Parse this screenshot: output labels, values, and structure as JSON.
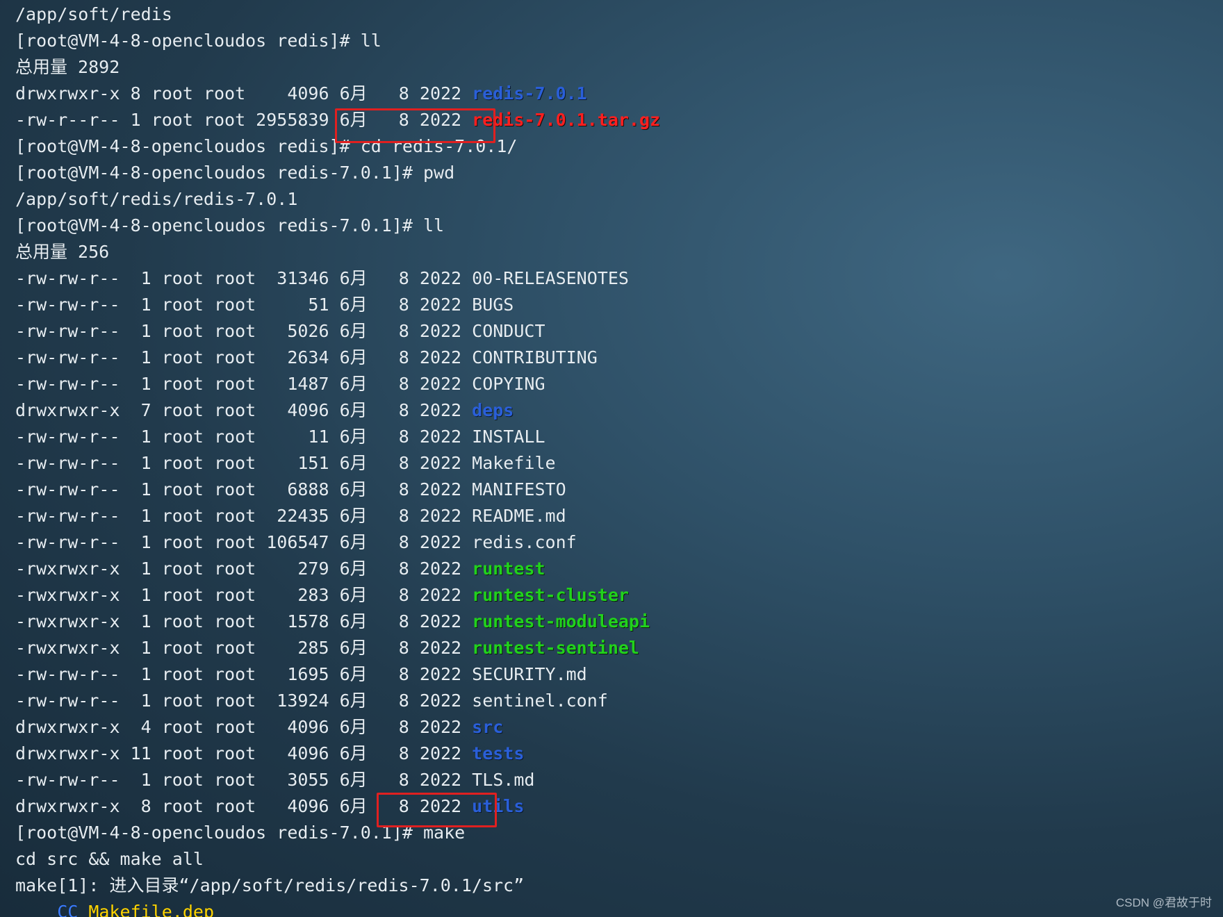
{
  "terminal": {
    "lines": [
      {
        "text": "/app/soft/redis"
      },
      {
        "text": "[root@VM-4-8-opencloudos redis]# ll"
      },
      {
        "text": "总用量 2892"
      },
      {
        "prefix": "drwxrwxr-x 8 root root    4096 6月   8 2022 ",
        "name": "redis-7.0.1",
        "color": "blue"
      },
      {
        "prefix": "-rw-r--r-- 1 root root 2955839 6月   8 2022 ",
        "name": "redis-7.0.1.tar.gz",
        "color": "red"
      },
      {
        "text": "[root@VM-4-8-opencloudos redis]# cd redis-7.0.1/"
      },
      {
        "text": "[root@VM-4-8-opencloudos redis-7.0.1]# pwd"
      },
      {
        "text": "/app/soft/redis/redis-7.0.1"
      },
      {
        "text": "[root@VM-4-8-opencloudos redis-7.0.1]# ll"
      },
      {
        "text": "总用量 256"
      },
      {
        "prefix": "-rw-rw-r--  1 root root  31346 6月   8 2022 ",
        "name": "00-RELEASENOTES"
      },
      {
        "prefix": "-rw-rw-r--  1 root root     51 6月   8 2022 ",
        "name": "BUGS"
      },
      {
        "prefix": "-rw-rw-r--  1 root root   5026 6月   8 2022 ",
        "name": "CONDUCT"
      },
      {
        "prefix": "-rw-rw-r--  1 root root   2634 6月   8 2022 ",
        "name": "CONTRIBUTING"
      },
      {
        "prefix": "-rw-rw-r--  1 root root   1487 6月   8 2022 ",
        "name": "COPYING"
      },
      {
        "prefix": "drwxrwxr-x  7 root root   4096 6月   8 2022 ",
        "name": "deps",
        "color": "blue"
      },
      {
        "prefix": "-rw-rw-r--  1 root root     11 6月   8 2022 ",
        "name": "INSTALL"
      },
      {
        "prefix": "-rw-rw-r--  1 root root    151 6月   8 2022 ",
        "name": "Makefile"
      },
      {
        "prefix": "-rw-rw-r--  1 root root   6888 6月   8 2022 ",
        "name": "MANIFESTO"
      },
      {
        "prefix": "-rw-rw-r--  1 root root  22435 6月   8 2022 ",
        "name": "README.md"
      },
      {
        "prefix": "-rw-rw-r--  1 root root 106547 6月   8 2022 ",
        "name": "redis.conf"
      },
      {
        "prefix": "-rwxrwxr-x  1 root root    279 6月   8 2022 ",
        "name": "runtest",
        "color": "green"
      },
      {
        "prefix": "-rwxrwxr-x  1 root root    283 6月   8 2022 ",
        "name": "runtest-cluster",
        "color": "green"
      },
      {
        "prefix": "-rwxrwxr-x  1 root root   1578 6月   8 2022 ",
        "name": "runtest-moduleapi",
        "color": "green"
      },
      {
        "prefix": "-rwxrwxr-x  1 root root    285 6月   8 2022 ",
        "name": "runtest-sentinel",
        "color": "green"
      },
      {
        "prefix": "-rw-rw-r--  1 root root   1695 6月   8 2022 ",
        "name": "SECURITY.md"
      },
      {
        "prefix": "-rw-rw-r--  1 root root  13924 6月   8 2022 ",
        "name": "sentinel.conf"
      },
      {
        "prefix": "drwxrwxr-x  4 root root   4096 6月   8 2022 ",
        "name": "src",
        "color": "blue"
      },
      {
        "prefix": "drwxrwxr-x 11 root root   4096 6月   8 2022 ",
        "name": "tests",
        "color": "blue"
      },
      {
        "prefix": "-rw-rw-r--  1 root root   3055 6月   8 2022 ",
        "name": "TLS.md"
      },
      {
        "prefix": "drwxrwxr-x  8 root root   4096 6月   8 2022 ",
        "name": "utils",
        "color": "blue"
      },
      {
        "text": "[root@VM-4-8-opencloudos redis-7.0.1]# make"
      },
      {
        "text": "cd src && make all"
      },
      {
        "text": "make[1]: 进入目录“/app/soft/redis/redis-7.0.1/src”"
      },
      {
        "prefix": "    ",
        "cc": "CC",
        "name": " Makefile.dep",
        "color": "yellow"
      }
    ],
    "colors": {
      "blue": "#2a5fd9",
      "red": "#ff1f1f",
      "green": "#21d21c",
      "yellow": "#ffd400",
      "cc": "#3a7bff",
      "highlight_border": "#e02020"
    }
  },
  "annotations": {
    "boxes": [
      {
        "label": "cd redis-7.0.1/"
      },
      {
        "label": "make"
      }
    ]
  },
  "watermark": {
    "text": "CSDN @君故于时"
  }
}
